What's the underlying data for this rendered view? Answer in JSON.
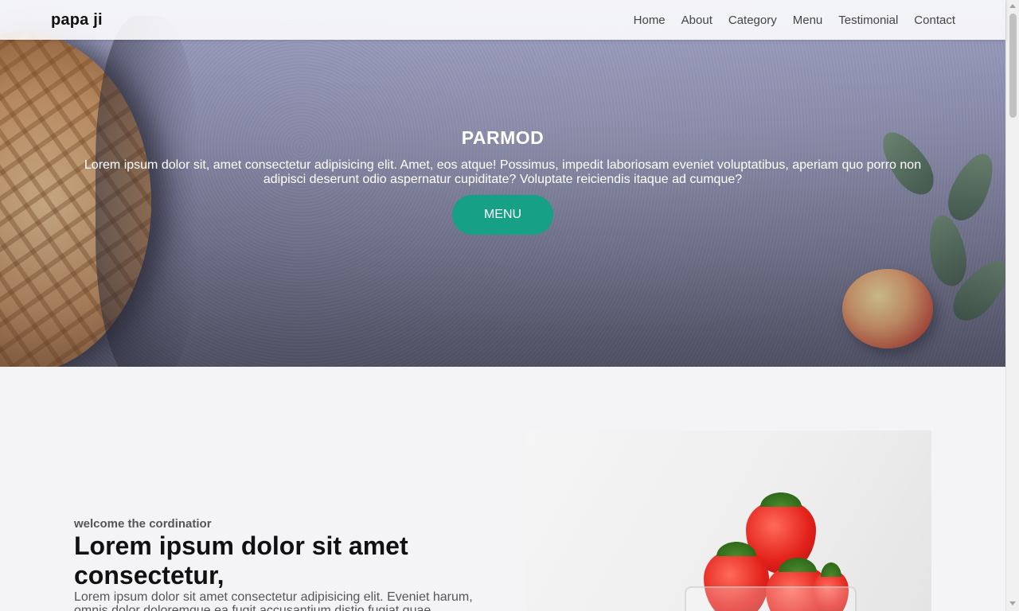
{
  "header": {
    "logo": "papa ji",
    "nav": [
      "Home",
      "About",
      "Category",
      "Menu",
      "Testimonial",
      "Contact"
    ]
  },
  "hero": {
    "title": "PARMOD",
    "text": "Lorem ipsum dolor sit, amet consectetur adipisicing elit. Amet, eos atque! Possimus, impedit laboriosam eveniet voluptatibus, aperiam quo porro non adipisci deserunt odio aspernatur cupiditate? Voluptate reiciendis itaque ad cumque?",
    "button": "MENU"
  },
  "about": {
    "subtitle": "welcome the cordinatior",
    "heading": "Lorem ipsum dolor sit amet consectetur,",
    "text": "Lorem ipsum dolor sit amet consectetur adipisicing elit. Eveniet harum, omnis dolor doloremque ea fugit accusantium distio fugiat quae"
  },
  "colors": {
    "accent": "#16a085",
    "background": "#f4f4f6"
  }
}
